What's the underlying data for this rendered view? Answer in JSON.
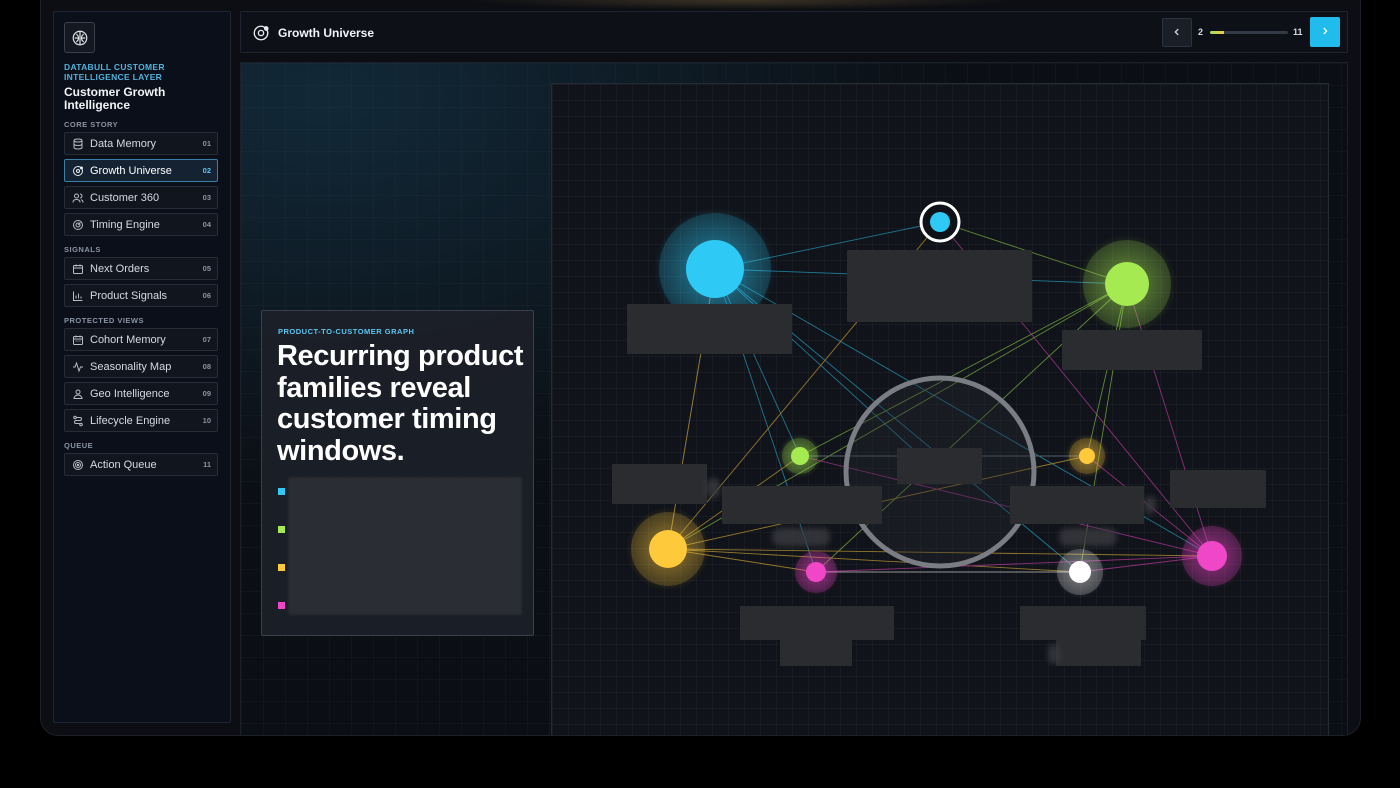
{
  "brand": {
    "eyebrow": "DATABULL CUSTOMER INTELLIGENCE LAYER",
    "title": "Customer Growth Intelligence",
    "icon": "brain-icon"
  },
  "nav": {
    "sections": [
      {
        "label": "CORE STORY"
      },
      {
        "label": "SIGNALS"
      },
      {
        "label": "PROTECTED VIEWS"
      },
      {
        "label": "QUEUE"
      }
    ],
    "items": [
      {
        "label": "Data Memory",
        "num": "01",
        "icon": "database-icon"
      },
      {
        "label": "Growth Universe",
        "num": "02",
        "icon": "orbit-icon",
        "active": true
      },
      {
        "label": "Customer 360",
        "num": "03",
        "icon": "users-icon"
      },
      {
        "label": "Timing Engine",
        "num": "04",
        "icon": "timer-icon"
      },
      {
        "label": "Next Orders",
        "num": "05",
        "icon": "calendar-icon"
      },
      {
        "label": "Product Signals",
        "num": "06",
        "icon": "bar-chart-icon"
      },
      {
        "label": "Cohort Memory",
        "num": "07",
        "icon": "calendar-icon"
      },
      {
        "label": "Seasonality Map",
        "num": "08",
        "icon": "pulse-icon"
      },
      {
        "label": "Geo Intelligence",
        "num": "09",
        "icon": "map-pin-icon"
      },
      {
        "label": "Lifecycle Engine",
        "num": "10",
        "icon": "route-icon"
      },
      {
        "label": "Action Queue",
        "num": "11",
        "icon": "target-icon"
      }
    ]
  },
  "header": {
    "title": "Growth Universe",
    "icon": "orbit-icon",
    "page_current": "2",
    "page_total": "11",
    "progress": 0.18
  },
  "card": {
    "eyebrow": "PRODUCT-TO-CUSTOMER GRAPH",
    "headline": "Recurring product families reveal customer timing windows."
  },
  "colors": {
    "cyan": "#2ec9f5",
    "green": "#a6ea52",
    "yellow": "#ffc93c",
    "magenta": "#f046c8",
    "white": "#ffffff",
    "accent": "#1fbcec"
  }
}
